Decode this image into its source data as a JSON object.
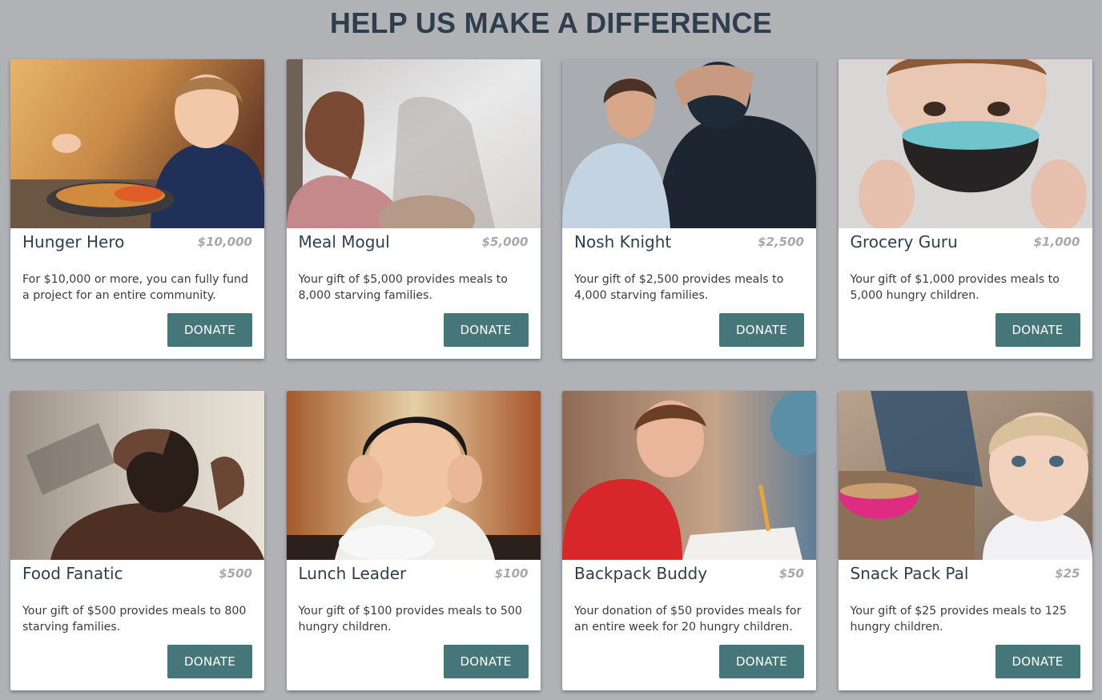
{
  "header": {
    "title": "HELP US MAKE A DIFFERENCE"
  },
  "colors": {
    "background": "#b1b2b6",
    "title": "#2f3e4c",
    "button": "#45777a",
    "amount": "#a8a8a8"
  },
  "cards": [
    {
      "name": "Hunger Hero",
      "amount": "$10,000",
      "description": "For $10,000 or more, you can fully fund a project for an entire community.",
      "button_label": "DONATE",
      "image": "boy-eating-plate-photo"
    },
    {
      "name": "Meal Mogul",
      "amount": "$5,000",
      "description": "Your gift of $5,000 provides meals to 8,000 starving families.",
      "button_label": "DONATE",
      "image": "girl-at-rainy-window-photo"
    },
    {
      "name": "Nosh Knight",
      "amount": "$2,500",
      "description": "Your gift of $2,500 provides meals to 4,000 starving families.",
      "button_label": "DONATE",
      "image": "boy-with-distressed-father-photo"
    },
    {
      "name": "Grocery Guru",
      "amount": "$1,000",
      "description": "Your gift of $1,000 provides meals to 5,000 hungry children.",
      "button_label": "DONATE",
      "image": "child-holding-empty-bowl-photo"
    },
    {
      "name": "Food Fanatic",
      "amount": "$500",
      "description": "Your gift of $500 provides meals to 800 starving families.",
      "button_label": "DONATE",
      "image": "boy-hands-on-head-photo"
    },
    {
      "name": "Lunch Leader",
      "amount": "$100",
      "description": "Your gift of $100 provides meals to 500 hungry children.",
      "button_label": "DONATE",
      "image": "sad-child-with-bowl-photo"
    },
    {
      "name": "Backpack Buddy",
      "amount": "$50",
      "description": "Your donation of $50 provides meals for an entire week for 20 hungry children.",
      "button_label": "DONATE",
      "image": "boy-writing-at-desk-photo"
    },
    {
      "name": "Snack Pack Pal",
      "amount": "$25",
      "description": "Your gift of $25 provides meals to 125 hungry children.",
      "button_label": "DONATE",
      "image": "toddler-with-snack-bowl-photo"
    }
  ]
}
